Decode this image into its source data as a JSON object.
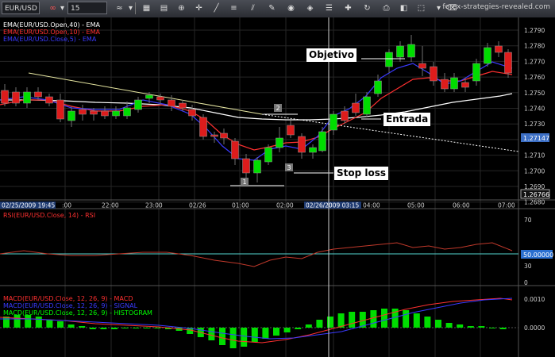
{
  "toolbar": {
    "symbol": "EUR/USD",
    "timeframe": "15 minutes",
    "watermark": "forex-strategies-revealed.com"
  },
  "main_panel": {
    "legend": [
      {
        "text": "EMA(EUR/USD.Open,40) - EMA",
        "color": "#ffffff"
      },
      {
        "text": "EMA(EUR/USD.Open,10) - EMA",
        "color": "#ff3030"
      },
      {
        "text": "EMA(EUR/USD.Close,5) - EMA",
        "color": "#3a3aff"
      }
    ],
    "price_labels": [
      "1.2790",
      "1.2780",
      "1.2770",
      "1.2760",
      "1.2750",
      "1.2740",
      "1.2730",
      "1.2720",
      "1.2710",
      "1.2700",
      "1.2690",
      "1.2680"
    ],
    "current_price": "1.27147",
    "low_price": "1.26766",
    "annotations": {
      "objective": "Objetivo",
      "entry": "Entrada",
      "stop_loss": "Stop loss"
    },
    "markers": [
      "1",
      "2",
      "3"
    ]
  },
  "time_axis": {
    "left_label": "02/25/2009 19:45",
    "cursor_label": "02/26/2009 03:15",
    "labels": [
      ":00",
      "22:00",
      "23:00",
      "02/26",
      "01:00",
      "02:00",
      "04:00",
      "05:00",
      "06:00",
      "07:00"
    ]
  },
  "rsi_panel": {
    "legend": "RSI(EUR/USD.Close, 14) - RSI",
    "labels": [
      "70",
      "50",
      "30",
      "0"
    ],
    "value": "50.00000"
  },
  "macd_panel": {
    "legend": [
      {
        "text": "MACD(EUR/USD.Close, 12, 26, 9) - MACD",
        "color": "#ff3030"
      },
      {
        "text": "MACD(EUR/USD.Close, 12, 26, 9) - SIGNAL",
        "color": "#3a3aff"
      },
      {
        "text": "MACD(EUR/USD.Close, 12, 26, 9) - HISTOGRAM",
        "color": "#00ff00"
      }
    ],
    "labels": [
      "0.0010",
      "0.0000"
    ]
  },
  "colors": {
    "up": "#00dd00",
    "down": "#dd1c1c",
    "axis_text": "#d0d0d0",
    "cursor": "#cfcfcf"
  }
}
